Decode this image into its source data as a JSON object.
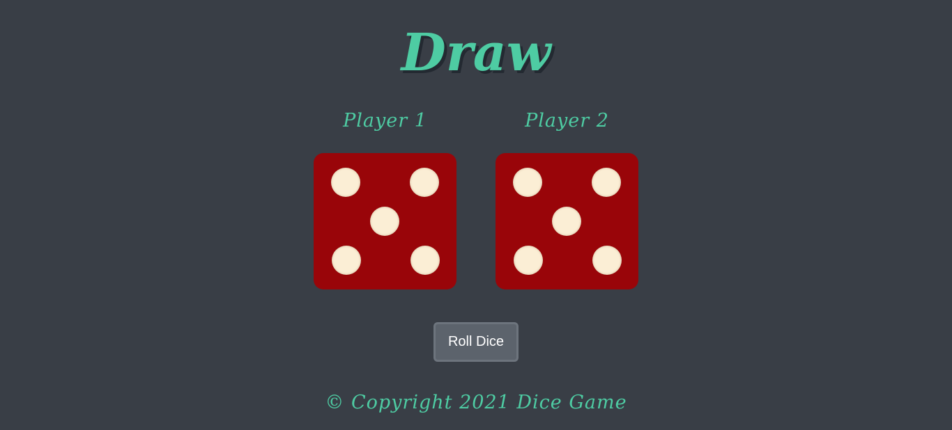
{
  "game": {
    "title": "Draw",
    "roll_button_label": "Roll Dice",
    "footer_text": "© Copyright 2021 Dice Game"
  },
  "players": [
    {
      "label": "Player 1",
      "die_value": 5
    },
    {
      "label": "Player 2",
      "die_value": 5
    }
  ],
  "colors": {
    "background": "#393e46",
    "accent": "#4ecca3",
    "die_face": "#990509",
    "pip": "#fbeed5",
    "button": "#5c636c"
  }
}
